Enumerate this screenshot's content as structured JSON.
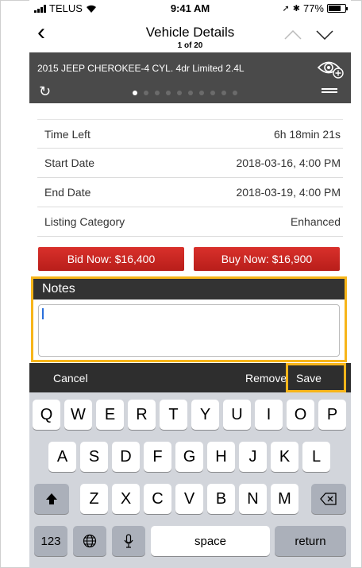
{
  "status_bar": {
    "carrier": "TELUS",
    "time": "9:41 AM",
    "battery": "77%",
    "battery_level": 0.77
  },
  "nav": {
    "title": "Vehicle Details",
    "subtitle": "1 of 20"
  },
  "vehicle": {
    "title": "2015 JEEP CHEROKEE-4 CYL. 4dr Limited 2.4L",
    "page_dots": 10,
    "active_dot": 0
  },
  "details": [
    {
      "label": "Time Left",
      "value": "6h 18min 21s"
    },
    {
      "label": "Start Date",
      "value": "2018-03-16, 4:00 PM"
    },
    {
      "label": "End Date",
      "value": "2018-03-19, 4:00 PM"
    },
    {
      "label": "Listing Category",
      "value": "Enhanced"
    }
  ],
  "actions": {
    "bid": "Bid Now: $16,400",
    "buy": "Buy Now: $16,900"
  },
  "notes": {
    "header": "Notes",
    "value": ""
  },
  "toolbar": {
    "cancel": "Cancel",
    "remove": "Remove",
    "save": "Save"
  },
  "keyboard": {
    "row1": [
      "Q",
      "W",
      "E",
      "R",
      "T",
      "Y",
      "U",
      "I",
      "O",
      "P"
    ],
    "row2": [
      "A",
      "S",
      "D",
      "F",
      "G",
      "H",
      "J",
      "K",
      "L"
    ],
    "row3": [
      "Z",
      "X",
      "C",
      "V",
      "B",
      "N",
      "M"
    ],
    "numbers": "123",
    "space": "space",
    "return": "return"
  },
  "colors": {
    "accent_highlight": "#f7b51a",
    "button_red": "#c8251f",
    "header_dark": "#4a4a4a"
  }
}
